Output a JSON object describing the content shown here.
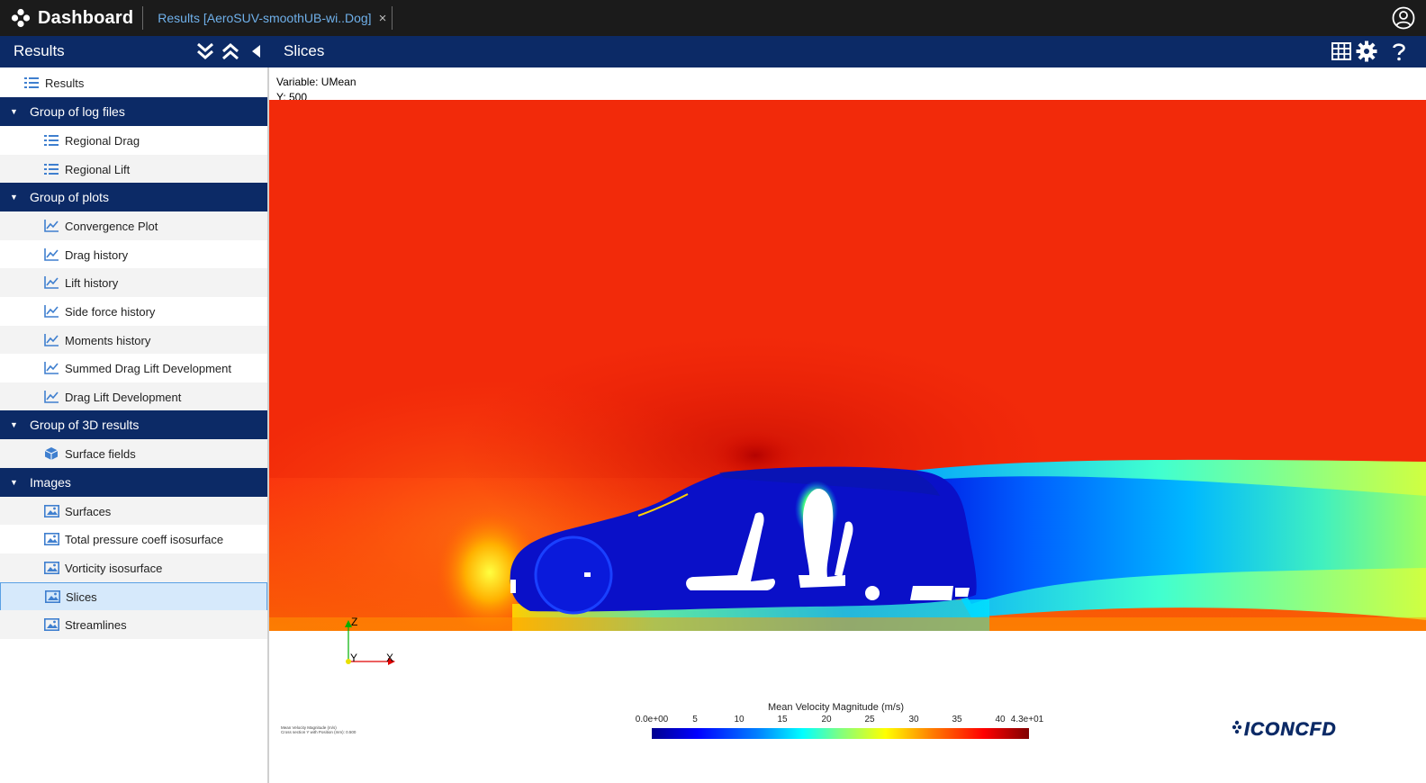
{
  "topbar": {
    "brand": "Dashboard",
    "tab_label": "Results [AeroSUV-smoothUB-wi..Dog]",
    "tab_close": "×",
    "icons": {
      "brand": "dots-logo-icon",
      "user": "user-circle-icon"
    }
  },
  "left_panel": {
    "title": "Results",
    "icons": [
      "expand-all-icon",
      "collapse-all-icon",
      "collapse-left-icon"
    ]
  },
  "right_panel": {
    "title": "Slices",
    "icons": [
      "grid-icon",
      "gear-icon",
      "help-icon"
    ]
  },
  "tree": {
    "root": {
      "label": "Results",
      "icon": "list-icon"
    },
    "groups": [
      {
        "label": "Group of log files",
        "items": [
          {
            "label": "Regional Drag",
            "icon": "list-icon"
          },
          {
            "label": "Regional Lift",
            "icon": "list-icon"
          }
        ]
      },
      {
        "label": "Group of plots",
        "items": [
          {
            "label": "Convergence Plot",
            "icon": "line-chart-icon"
          },
          {
            "label": "Drag history",
            "icon": "line-chart-icon"
          },
          {
            "label": "Lift history",
            "icon": "line-chart-icon"
          },
          {
            "label": "Side force history",
            "icon": "line-chart-icon"
          },
          {
            "label": "Moments history",
            "icon": "line-chart-icon"
          },
          {
            "label": "Summed Drag Lift Development",
            "icon": "line-chart-icon"
          },
          {
            "label": "Drag Lift Development",
            "icon": "line-chart-icon"
          }
        ]
      },
      {
        "label": "Group of 3D results",
        "items": [
          {
            "label": "Surface fields",
            "icon": "cube-icon"
          }
        ]
      },
      {
        "label": "Images",
        "items": [
          {
            "label": "Surfaces",
            "icon": "image-icon"
          },
          {
            "label": "Total pressure coeff isosurface",
            "icon": "image-icon"
          },
          {
            "label": "Vorticity isosurface",
            "icon": "image-icon"
          },
          {
            "label": "Slices",
            "icon": "image-icon",
            "selected": true
          },
          {
            "label": "Streamlines",
            "icon": "image-icon"
          }
        ]
      }
    ]
  },
  "view": {
    "variable_line": "Variable: UMean",
    "position_line": "Y: 500",
    "axis_labels": {
      "z": "Z",
      "y": "Y",
      "x": "X"
    },
    "small_note_1": "Mean Velocity Magnitude (m/s)",
    "small_note_2": "Cross section Y with Position (mm): 0.500",
    "legend": {
      "title": "Mean Velocity Magnitude (m/s)",
      "ticks": [
        "0.0e+00",
        "5",
        "10",
        "15",
        "20",
        "25",
        "30",
        "35",
        "40",
        "4.3e+01"
      ]
    },
    "logo_text": "ICONCFD"
  },
  "colors": {
    "topbar": "#1b1b1b",
    "header": "#0c2a66",
    "accent_blue": "#6fb0ea",
    "selection": "#d6e9fb"
  }
}
